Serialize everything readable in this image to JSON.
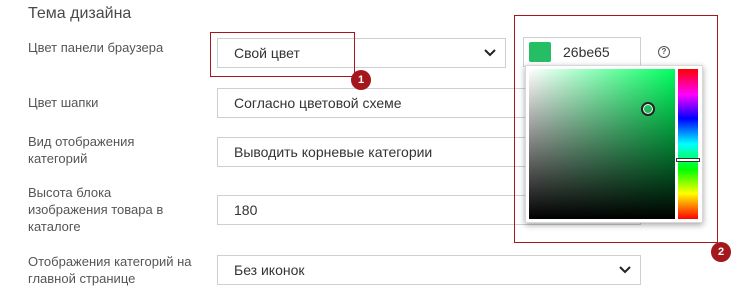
{
  "section": {
    "title": "Тема дизайна"
  },
  "rows": [
    {
      "label": "Цвет панели браузера",
      "value": "Свой цвет"
    },
    {
      "label": "Цвет шапки",
      "value": "Согласно цветовой схеме"
    },
    {
      "label": "Вид отображения категорий",
      "value": "Выводить корневые категории"
    },
    {
      "label": "Высота блока изображения товара в каталоге",
      "value": "180"
    },
    {
      "label": "Отображения категорий на главной странице",
      "value": "Без иконок"
    }
  ],
  "color_picker": {
    "value": "26be65",
    "swatch_color": "#26be65",
    "area_hue_color": "#00ff60",
    "help_icon": "question-circle-icon"
  },
  "callouts": [
    {
      "number": "1"
    },
    {
      "number": "2"
    }
  ],
  "colors": {
    "accent": "#a3171d"
  }
}
